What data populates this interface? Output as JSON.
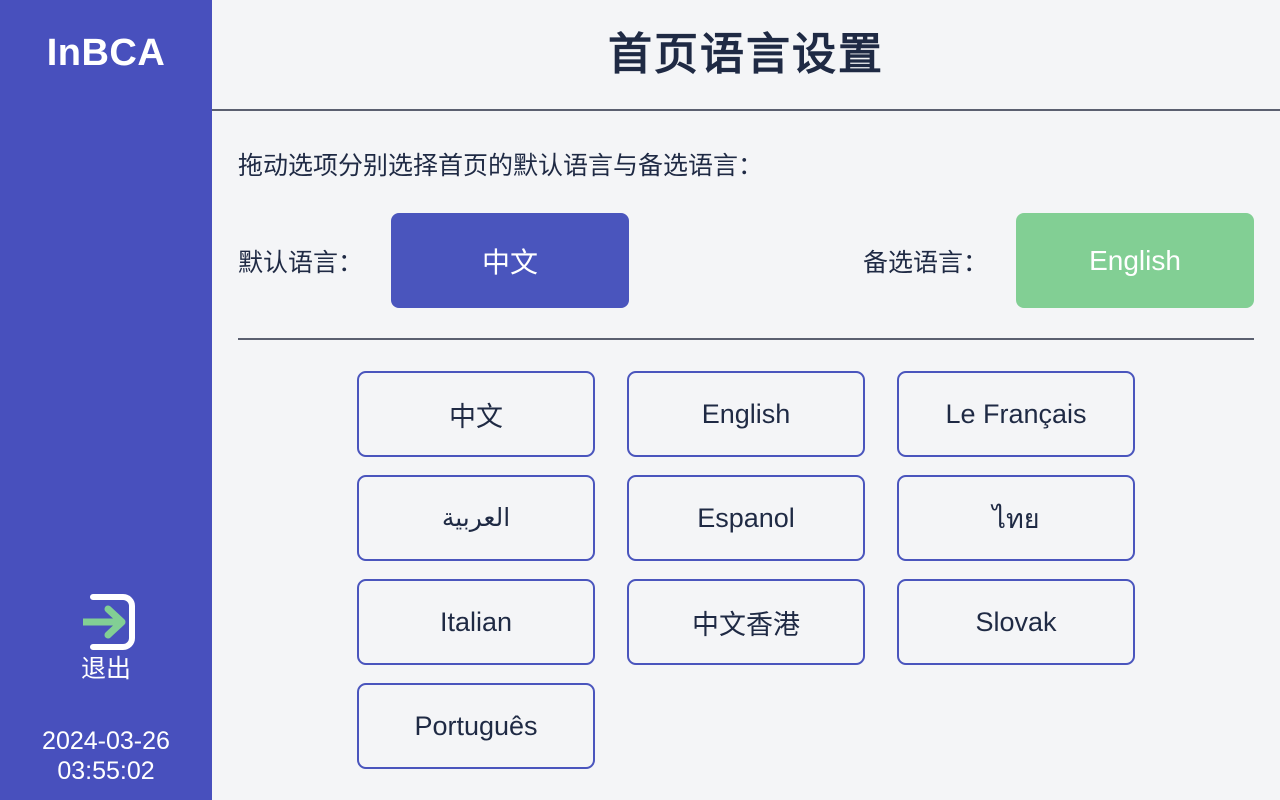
{
  "colors": {
    "sidebar_bg": "#4850bd",
    "accent_purple": "#4a55bd",
    "accent_green": "#82cf94",
    "page_bg": "#f4f5f7",
    "text_dark": "#1f2a44",
    "divider": "#5b6070"
  },
  "sidebar": {
    "logo": "InBCA",
    "exit_icon": "exit-arrow-icon",
    "exit_label": "退出",
    "date": "2024-03-26",
    "time": "03:55:02"
  },
  "header": {
    "title": "首页语言设置"
  },
  "main": {
    "instruction": "拖动选项分别选择首页的默认语言与备选语言：",
    "default_language": {
      "label": "默认语言：",
      "value": "中文"
    },
    "alternate_language": {
      "label": "备选语言：",
      "value": "English"
    },
    "language_options": [
      {
        "label": "中文",
        "rtl": false
      },
      {
        "label": "English",
        "rtl": false
      },
      {
        "label": "Le Français",
        "rtl": false
      },
      {
        "label": "العربية",
        "rtl": true
      },
      {
        "label": "Espanol",
        "rtl": false
      },
      {
        "label": "ไทย",
        "rtl": false
      },
      {
        "label": "Italian",
        "rtl": false
      },
      {
        "label": "中文香港",
        "rtl": false
      },
      {
        "label": "Slovak",
        "rtl": false
      },
      {
        "label": "Português",
        "rtl": false
      }
    ]
  }
}
